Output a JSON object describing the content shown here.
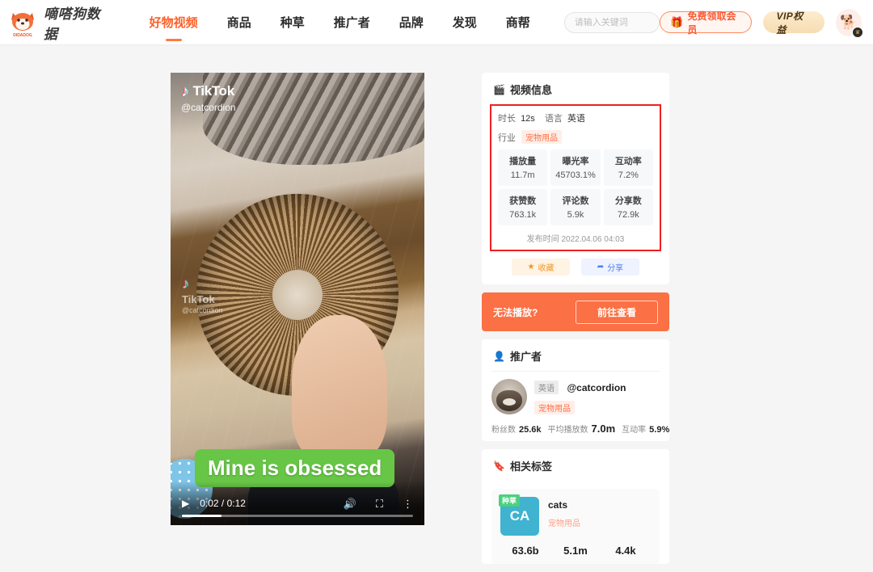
{
  "header": {
    "brand": "嘀嗒狗数据",
    "logo_icon": "dog-head-icon",
    "logo_sub": "DIDADOG",
    "nav": [
      {
        "label": "好物视频",
        "active": true
      },
      {
        "label": "商品",
        "active": false
      },
      {
        "label": "种草",
        "active": false
      },
      {
        "label": "推广者",
        "active": false
      },
      {
        "label": "品牌",
        "active": false
      },
      {
        "label": "发现",
        "active": false
      },
      {
        "label": "商帮",
        "active": false
      }
    ],
    "search": {
      "placeholder": "请输入关键词",
      "value": ""
    },
    "member_button": {
      "label": "免费领取会员",
      "icon": "gift-icon"
    },
    "vip_button": {
      "label": "VIP权益"
    },
    "avatar": {
      "icon": "dog-avatar-icon",
      "badge_icon": "crown-icon"
    }
  },
  "video": {
    "watermark_brand": "TikTok",
    "watermark_user": "@catcordion",
    "watermark_mid_brand": "TikTok",
    "watermark_mid_user": "@catcordion",
    "caption": "Mine is obsessed",
    "controls": {
      "play_icon": "play-icon",
      "time": "0:02 / 0:12",
      "volume_icon": "volume-icon",
      "fullscreen_icon": "fullscreen-icon",
      "more_icon": "more-vertical-icon"
    }
  },
  "video_info": {
    "title": "视频信息",
    "title_icon": "video-icon",
    "duration_label": "时长",
    "duration_value": "12s",
    "language_label": "语言",
    "language_value": "英语",
    "industry_label": "行业",
    "industry_value": "宠物用品",
    "stats": [
      {
        "label": "播放量",
        "value": "11.7m"
      },
      {
        "label": "曝光率",
        "value": "45703.1%"
      },
      {
        "label": "互动率",
        "value": "7.2%"
      },
      {
        "label": "获赞数",
        "value": "763.1k"
      },
      {
        "label": "评论数",
        "value": "5.9k"
      },
      {
        "label": "分享数",
        "value": "72.9k"
      }
    ],
    "publish_label": "发布时间",
    "publish_time": "2022.04.06 04:03",
    "favorite_button": {
      "label": "收藏",
      "icon": "star-icon"
    },
    "share_button": {
      "label": "分享",
      "icon": "share-arrow-icon"
    }
  },
  "banner": {
    "text": "无法播放?",
    "button_label": "前往查看"
  },
  "promoter": {
    "title": "推广者",
    "title_icon": "user-icon",
    "avatar_icon": "cat-avatar-icon",
    "language_chip": "英语",
    "name": "@catcordion",
    "category": "宠物用品",
    "stats": [
      {
        "label": "粉丝数",
        "value": "25.6k"
      },
      {
        "label": "平均播放数",
        "value": "7.0m"
      },
      {
        "label": "互动率",
        "value": "5.9%"
      }
    ]
  },
  "related_tags": {
    "title": "相关标签",
    "title_icon": "tag-icon",
    "items": [
      {
        "badge": "种草",
        "thumb_text": "CA",
        "name": "cats",
        "category": "宠物用品",
        "numbers": [
          "63.6b",
          "5.1m",
          "4.4k"
        ]
      }
    ]
  },
  "colors": {
    "accent": "#ff5f28",
    "banner": "#fb7044",
    "highlight_box": "#f01f1f",
    "caption_green": "#68c647",
    "tag_thumb": "#3fb3cf"
  }
}
